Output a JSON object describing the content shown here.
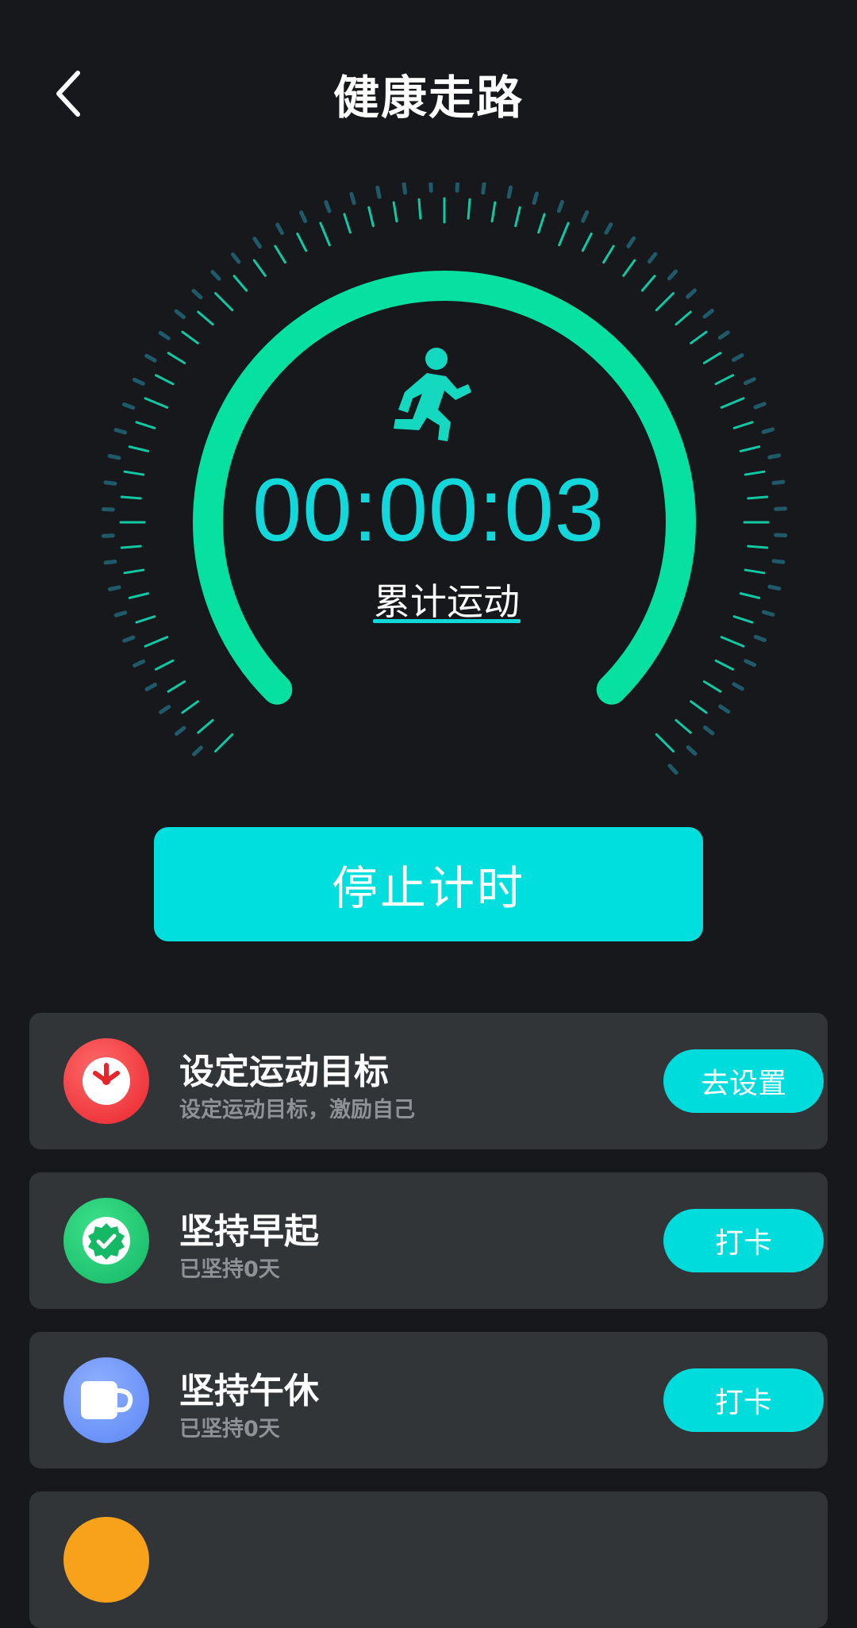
{
  "header": {
    "title": "健康走路"
  },
  "timer": {
    "value": "00:00:03",
    "label": "累计运动",
    "progress_arc_percent": 100
  },
  "actions": {
    "stop_label": "停止计时"
  },
  "tasks": [
    {
      "title": "设定运动目标",
      "subtitle": "设定运动目标，激励自己",
      "button": "去设置",
      "icon": "clock-icon",
      "color": "#e8242c"
    },
    {
      "title": "坚持早起",
      "subtitle": "已坚持0天",
      "button": "打卡",
      "icon": "badge-check-icon",
      "color": "#14b865"
    },
    {
      "title": "坚持午休",
      "subtitle": "已坚持0天",
      "button": "打卡",
      "icon": "cup-icon",
      "color": "#5b86f5"
    }
  ],
  "colors": {
    "accent": "#00dfde",
    "arc": "#06e0a0",
    "background": "#17181b",
    "card": "#323538"
  }
}
